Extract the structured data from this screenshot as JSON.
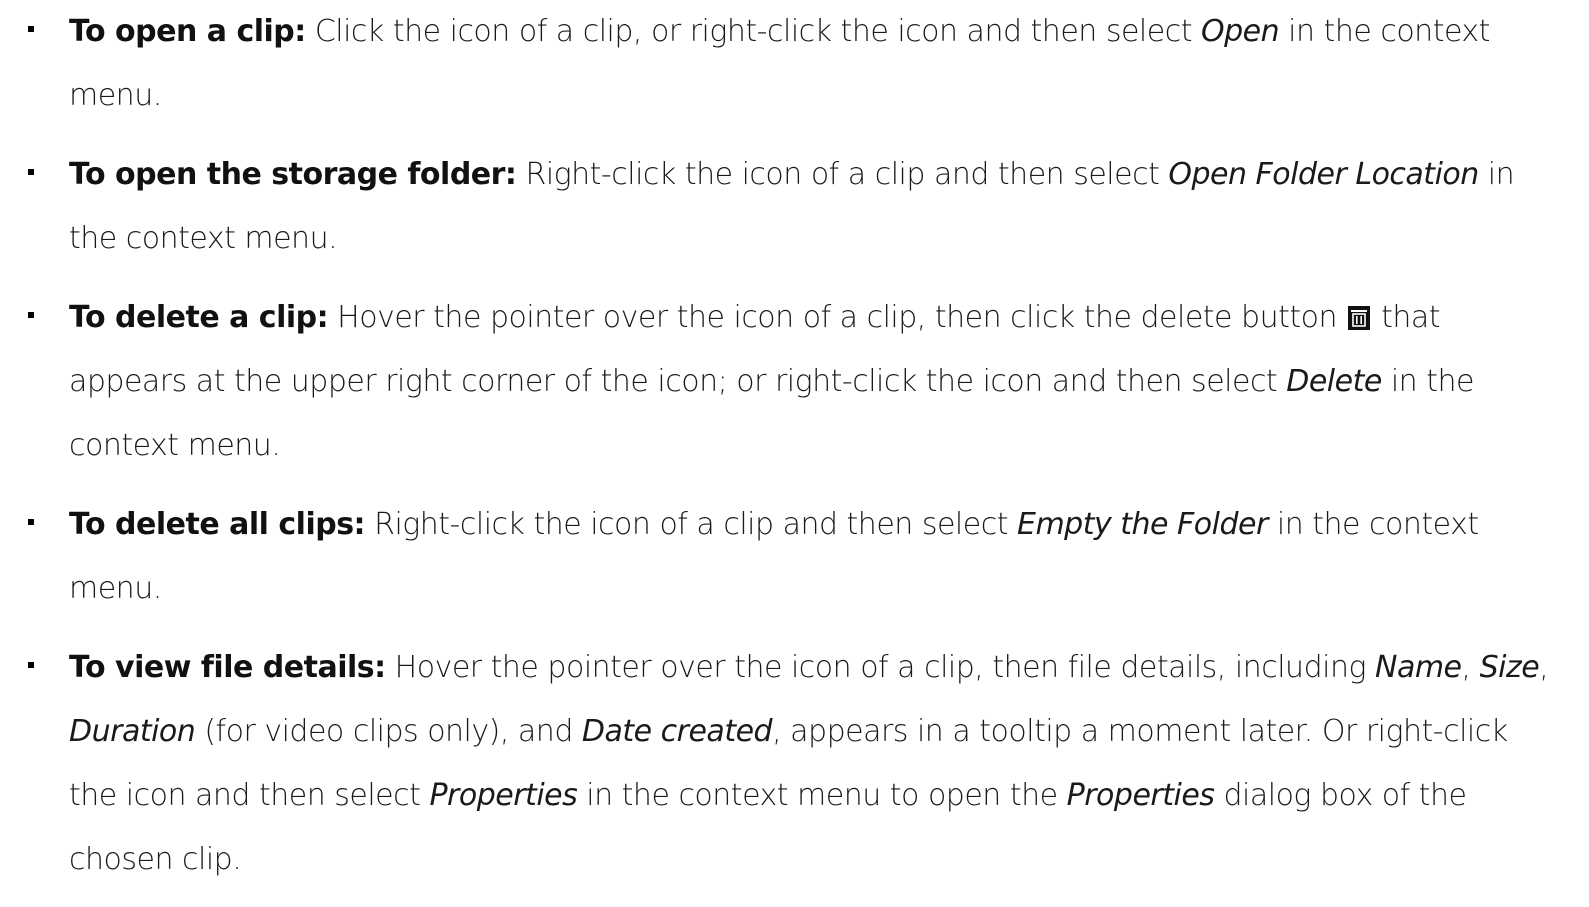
{
  "items": [
    {
      "term": "To open a clip:",
      "t1": " Click the icon of a clip, or right-click the icon and then select ",
      "e1": "Open",
      "t2": " in the context menu."
    },
    {
      "term": "To open the storage folder:",
      "t1": " Right-click the icon of a clip and then select ",
      "e1": "Open Folder Location",
      "t2": " in the context menu."
    },
    {
      "term": "To delete a clip:",
      "t1": " Hover the pointer over the icon of a clip, then click the delete button ",
      "icon": "trash-icon",
      "t2": " that appears at the upper right corner of the icon; or right-click the icon and then select ",
      "e1": "Delete",
      "t3": " in the context menu."
    },
    {
      "term": "To delete all clips:",
      "t1": " Right-click the icon of a clip and then select ",
      "e1": "Empty the Folder",
      "t2": " in the context menu."
    },
    {
      "term": "To view file details:",
      "t1": " Hover the pointer over the icon of a clip, then file details, including ",
      "e1": "Name",
      "t2": ", ",
      "e2": "Size",
      "t3": ", ",
      "e3": "Duration",
      "t4": " (for video clips only), and ",
      "e4": "Date created",
      "t5": ", appears in a tooltip a moment later. Or right-click the icon and then select ",
      "e5": "Properties",
      "t6": " in the context menu to open the ",
      "e6": "Properties",
      "t7": " dialog box of the chosen clip."
    }
  ]
}
